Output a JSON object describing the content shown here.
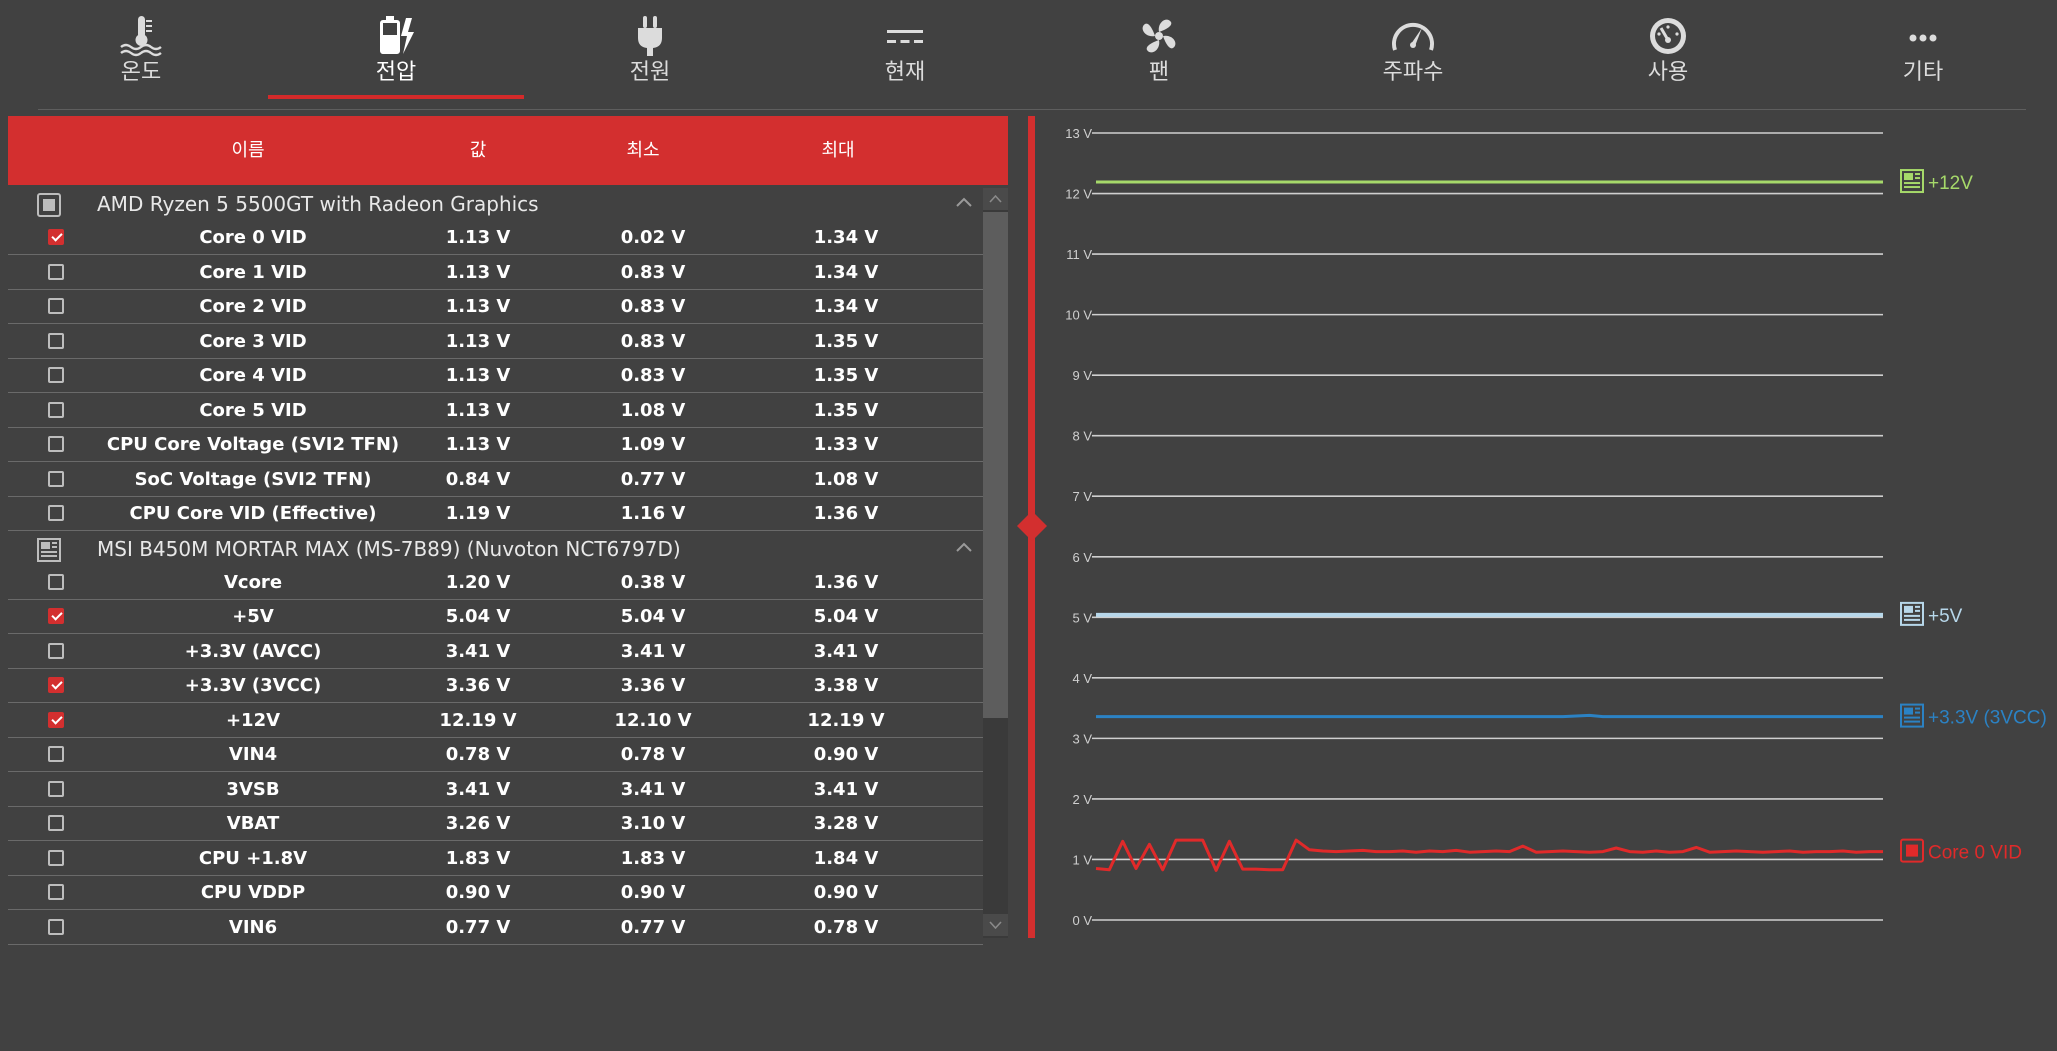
{
  "tabs": [
    {
      "label": "온도",
      "icon": "thermometer-water-icon",
      "active": false
    },
    {
      "label": "전압",
      "icon": "battery-bolt-icon",
      "active": true
    },
    {
      "label": "전원",
      "icon": "plug-icon",
      "active": false
    },
    {
      "label": "현재",
      "icon": "dc-current-icon",
      "active": false
    },
    {
      "label": "팬",
      "icon": "fan-icon",
      "active": false
    },
    {
      "label": "주파수",
      "icon": "speedometer-icon",
      "active": false
    },
    {
      "label": "사용",
      "icon": "gauge-icon",
      "active": false
    },
    {
      "label": "기타",
      "icon": "more-dots-icon",
      "active": false
    }
  ],
  "grid": {
    "columns": {
      "name": "이름",
      "value": "값",
      "min": "최소",
      "max": "최대"
    },
    "groups": [
      {
        "name": "AMD Ryzen 5 5500GT with Radeon Graphics",
        "icon": "cpu-chip-icon",
        "rows": [
          {
            "name": "Core 0 VID",
            "value": "1.13 V",
            "min": "0.02 V",
            "max": "1.34 V",
            "checked": true
          },
          {
            "name": "Core 1 VID",
            "value": "1.13 V",
            "min": "0.83 V",
            "max": "1.34 V",
            "checked": false
          },
          {
            "name": "Core 2 VID",
            "value": "1.13 V",
            "min": "0.83 V",
            "max": "1.34 V",
            "checked": false
          },
          {
            "name": "Core 3 VID",
            "value": "1.13 V",
            "min": "0.83 V",
            "max": "1.35 V",
            "checked": false
          },
          {
            "name": "Core 4 VID",
            "value": "1.13 V",
            "min": "0.83 V",
            "max": "1.35 V",
            "checked": false
          },
          {
            "name": "Core 5 VID",
            "value": "1.13 V",
            "min": "1.08 V",
            "max": "1.35 V",
            "checked": false
          },
          {
            "name": "CPU Core Voltage (SVI2 TFN)",
            "value": "1.13 V",
            "min": "1.09 V",
            "max": "1.33 V",
            "checked": false
          },
          {
            "name": "SoC Voltage (SVI2 TFN)",
            "value": "0.84 V",
            "min": "0.77 V",
            "max": "1.08 V",
            "checked": false
          },
          {
            "name": "CPU Core VID (Effective)",
            "value": "1.19 V",
            "min": "1.16 V",
            "max": "1.36 V",
            "checked": false
          }
        ]
      },
      {
        "name": "MSI B450M MORTAR MAX (MS-7B89) (Nuvoton NCT6797D)",
        "icon": "motherboard-icon",
        "rows": [
          {
            "name": "Vcore",
            "value": "1.20 V",
            "min": "0.38 V",
            "max": "1.36 V",
            "checked": false
          },
          {
            "name": "+5V",
            "value": "5.04 V",
            "min": "5.04 V",
            "max": "5.04 V",
            "checked": true
          },
          {
            "name": "+3.3V (AVCC)",
            "value": "3.41 V",
            "min": "3.41 V",
            "max": "3.41 V",
            "checked": false
          },
          {
            "name": "+3.3V (3VCC)",
            "value": "3.36 V",
            "min": "3.36 V",
            "max": "3.38 V",
            "checked": true
          },
          {
            "name": "+12V",
            "value": "12.19 V",
            "min": "12.10 V",
            "max": "12.19 V",
            "checked": true
          },
          {
            "name": "VIN4",
            "value": "0.78 V",
            "min": "0.78 V",
            "max": "0.90 V",
            "checked": false
          },
          {
            "name": "3VSB",
            "value": "3.41 V",
            "min": "3.41 V",
            "max": "3.41 V",
            "checked": false
          },
          {
            "name": "VBAT",
            "value": "3.26 V",
            "min": "3.10 V",
            "max": "3.28 V",
            "checked": false
          },
          {
            "name": "CPU +1.8V",
            "value": "1.83 V",
            "min": "1.83 V",
            "max": "1.84 V",
            "checked": false
          },
          {
            "name": "CPU VDDP",
            "value": "0.90 V",
            "min": "0.90 V",
            "max": "0.90 V",
            "checked": false
          },
          {
            "name": "VIN6",
            "value": "0.77 V",
            "min": "0.77 V",
            "max": "0.78 V",
            "checked": false
          }
        ]
      }
    ]
  },
  "colors": {
    "accent": "#d32f2f",
    "background": "#414141",
    "plus12v": "#a6d96a",
    "plus5v": "#b7d7ea",
    "plus33v": "#2b82c4",
    "core0": "#e02a2a"
  },
  "chart_data": {
    "type": "line",
    "ylim": [
      0,
      13
    ],
    "yticks": [
      "0 V",
      "1 V",
      "2 V",
      "3 V",
      "4 V",
      "5 V",
      "6 V",
      "7 V",
      "8 V",
      "9 V",
      "10 V",
      "11 V",
      "12 V",
      "13 V"
    ],
    "grid": true,
    "legend_position": "right",
    "series": [
      {
        "name": "+12V",
        "color": "#a6d96a",
        "icon": "motherboard-icon",
        "values": [
          12.19,
          12.19,
          12.19,
          12.19,
          12.19,
          12.19,
          12.19,
          12.19,
          12.19,
          12.19,
          12.19,
          12.19,
          12.19,
          12.19,
          12.19,
          12.19,
          12.19,
          12.19,
          12.19,
          12.19,
          12.19,
          12.19,
          12.19,
          12.19,
          12.19,
          12.19,
          12.19,
          12.19,
          12.19,
          12.19,
          12.19,
          12.19,
          12.19,
          12.19,
          12.19,
          12.19,
          12.19,
          12.19,
          12.19,
          12.19,
          12.19,
          12.19,
          12.19,
          12.19,
          12.19,
          12.19,
          12.19,
          12.19,
          12.19,
          12.19,
          12.19,
          12.19,
          12.19,
          12.19,
          12.19,
          12.19,
          12.19,
          12.19,
          12.19,
          12.19
        ]
      },
      {
        "name": "+5V",
        "color": "#b7d7ea",
        "icon": "motherboard-icon",
        "values": [
          5.04,
          5.04,
          5.04,
          5.04,
          5.04,
          5.04,
          5.04,
          5.04,
          5.04,
          5.04,
          5.04,
          5.04,
          5.04,
          5.04,
          5.04,
          5.04,
          5.04,
          5.04,
          5.04,
          5.04,
          5.04,
          5.04,
          5.04,
          5.04,
          5.04,
          5.04,
          5.04,
          5.04,
          5.04,
          5.04,
          5.04,
          5.04,
          5.04,
          5.04,
          5.04,
          5.04,
          5.04,
          5.04,
          5.04,
          5.04,
          5.04,
          5.04,
          5.04,
          5.04,
          5.04,
          5.04,
          5.04,
          5.04,
          5.04,
          5.04,
          5.04,
          5.04,
          5.04,
          5.04,
          5.04,
          5.04,
          5.04,
          5.04,
          5.04,
          5.04
        ]
      },
      {
        "name": "+3.3V (3VCC)",
        "color": "#2b82c4",
        "icon": "motherboard-icon",
        "values": [
          3.36,
          3.36,
          3.36,
          3.36,
          3.36,
          3.36,
          3.36,
          3.36,
          3.36,
          3.36,
          3.36,
          3.36,
          3.36,
          3.36,
          3.36,
          3.36,
          3.36,
          3.36,
          3.36,
          3.36,
          3.36,
          3.36,
          3.36,
          3.36,
          3.36,
          3.36,
          3.36,
          3.36,
          3.36,
          3.36,
          3.36,
          3.36,
          3.36,
          3.36,
          3.36,
          3.36,
          3.37,
          3.38,
          3.36,
          3.36,
          3.36,
          3.36,
          3.36,
          3.36,
          3.36,
          3.36,
          3.36,
          3.36,
          3.36,
          3.36,
          3.36,
          3.36,
          3.36,
          3.36,
          3.36,
          3.36,
          3.36,
          3.36,
          3.36,
          3.36
        ]
      },
      {
        "name": "Core 0 VID",
        "color": "#e02a2a",
        "icon": "cpu-chip-icon",
        "values": [
          0.85,
          0.83,
          1.3,
          0.85,
          1.25,
          0.83,
          1.32,
          1.32,
          1.32,
          0.82,
          1.3,
          0.84,
          0.84,
          0.83,
          0.83,
          1.32,
          1.16,
          1.14,
          1.13,
          1.14,
          1.15,
          1.13,
          1.13,
          1.14,
          1.12,
          1.14,
          1.13,
          1.15,
          1.12,
          1.13,
          1.14,
          1.13,
          1.22,
          1.12,
          1.13,
          1.14,
          1.13,
          1.12,
          1.13,
          1.19,
          1.13,
          1.12,
          1.14,
          1.12,
          1.13,
          1.2,
          1.12,
          1.13,
          1.14,
          1.13,
          1.12,
          1.13,
          1.14,
          1.12,
          1.13,
          1.13,
          1.14,
          1.12,
          1.13,
          1.13
        ]
      }
    ]
  }
}
